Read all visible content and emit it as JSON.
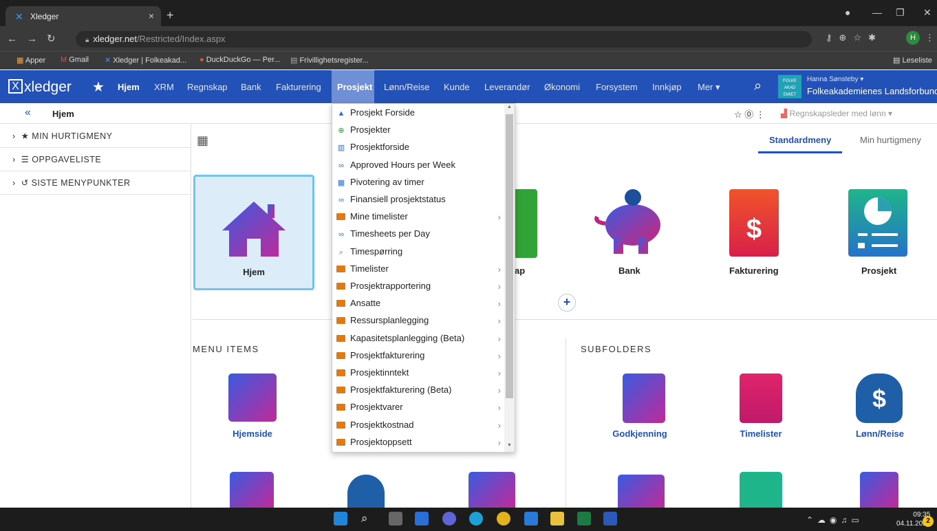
{
  "browser": {
    "tab_title": "Xledger",
    "url_host": "xledger.net",
    "url_path": "/Restricted/Index.aspx",
    "avatar_letter": "H",
    "bookmarks": [
      "Apper",
      "Gmail",
      "Xledger | Folkeakad...",
      "DuckDuckGo — Per...",
      "Frivillighetsregister..."
    ],
    "reading_list": "Leseliste"
  },
  "header": {
    "logo": "xledger",
    "nav": [
      "Hjem",
      "XRM",
      "Regnskap",
      "Bank",
      "Fakturering",
      "Prosjekt",
      "Lønn/Reise",
      "Kunde",
      "Leverandør",
      "Økonomi",
      "Forsystem",
      "Innkjøp",
      "Mer"
    ],
    "active_nav": "Prosjekt",
    "user_name": "Hanna Sønsteby",
    "org_name": "Folkeakademienes Landsforbund",
    "org_logo_text": "FOLKE AKAD EMIET"
  },
  "breadcrumb": {
    "title": "Hjem",
    "role": "Regnskapsleder med lønn"
  },
  "sidebar": {
    "items": [
      "MIN HURTIGMENY",
      "OPPGAVELISTE",
      "SISTE MENYPUNKTER"
    ]
  },
  "main": {
    "tabs": [
      "Standardmeny",
      "Min hurtigmeny"
    ],
    "active_tab": "Standardmeny",
    "tiles": [
      "Hjem",
      "ap",
      "Bank",
      "Fakturering",
      "Prosjekt"
    ],
    "menu_items_title": "MENU ITEMS",
    "subfolders_title": "SUBFOLDERS",
    "menu_items": [
      "Hjemside"
    ],
    "subfolders": [
      "Godkjenning",
      "Timelister",
      "Lønn/Reise"
    ]
  },
  "dropdown": {
    "items": [
      {
        "label": "Prosjekt Forside",
        "icon": "chart-area-icon",
        "sub": false
      },
      {
        "label": "Prosjekter",
        "icon": "search-plus-icon",
        "sub": false
      },
      {
        "label": "Prosjektforside",
        "icon": "bar-chart-icon",
        "sub": false
      },
      {
        "label": "Approved Hours per Week",
        "icon": "binoculars-icon",
        "sub": false
      },
      {
        "label": "Pivotering av timer",
        "icon": "grid-icon",
        "sub": false
      },
      {
        "label": "Finansiell prosjektstatus",
        "icon": "binoculars-icon",
        "sub": false
      },
      {
        "label": "Mine timelister",
        "icon": "folder-icon",
        "sub": true
      },
      {
        "label": "Timesheets per Day",
        "icon": "binoculars-icon",
        "sub": false
      },
      {
        "label": "Timespørring",
        "icon": "search-icon",
        "sub": false
      },
      {
        "label": "Timelister",
        "icon": "folder-icon",
        "sub": true
      },
      {
        "label": "Prosjektrapportering",
        "icon": "folder-icon",
        "sub": true
      },
      {
        "label": "Ansatte",
        "icon": "folder-icon",
        "sub": true
      },
      {
        "label": "Ressursplanlegging",
        "icon": "folder-icon",
        "sub": true
      },
      {
        "label": "Kapasitetsplanlegging (Beta)",
        "icon": "folder-icon",
        "sub": true
      },
      {
        "label": "Prosjektfakturering",
        "icon": "folder-icon",
        "sub": true
      },
      {
        "label": "Prosjektinntekt",
        "icon": "folder-icon",
        "sub": true
      },
      {
        "label": "Prosjektfakturering (Beta)",
        "icon": "folder-icon",
        "sub": true
      },
      {
        "label": "Prosjektvarer",
        "icon": "folder-icon",
        "sub": true
      },
      {
        "label": "Prosjektkostnad",
        "icon": "folder-icon",
        "sub": true
      },
      {
        "label": "Prosjektoppsett",
        "icon": "folder-icon",
        "sub": true
      }
    ]
  },
  "taskbar": {
    "time": "09:35",
    "date": "04.11.2021",
    "notifications": "2"
  }
}
